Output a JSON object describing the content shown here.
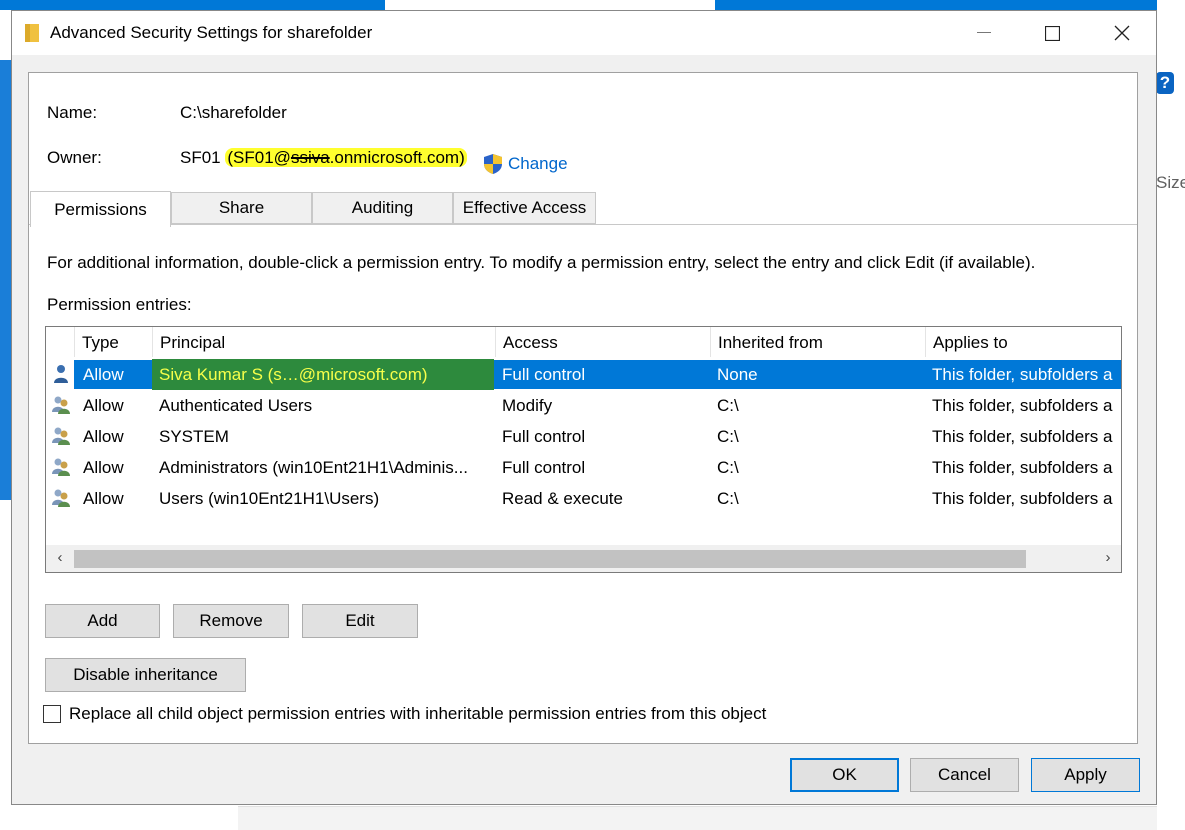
{
  "window": {
    "title": "Advanced Security Settings for sharefolder"
  },
  "object": {
    "name_label": "Name:",
    "name_value": "C:\\sharefolder",
    "owner_label": "Owner:",
    "owner_name": "SF01",
    "owner_email_prefix": "(SF01@",
    "owner_email_struck": "ssiva",
    "owner_email_suffix": ".onmicrosoft.com)",
    "change_link": "Change"
  },
  "tabs": [
    {
      "label": "Permissions",
      "active": true
    },
    {
      "label": "Share",
      "active": false
    },
    {
      "label": "Auditing",
      "active": false
    },
    {
      "label": "Effective Access",
      "active": false
    }
  ],
  "info_text": "For additional information, double-click a permission entry. To modify a permission entry, select the entry and click Edit (if available).",
  "entries_label": "Permission entries:",
  "table": {
    "columns": [
      "Type",
      "Principal",
      "Access",
      "Inherited from",
      "Applies to"
    ],
    "rows": [
      {
        "icon": "user-icon",
        "type": "Allow",
        "principal": "Siva Kumar S (s…@microsoft.com)",
        "access": "Full control",
        "inherited": "None",
        "applies": "This folder, subfolders a",
        "selected": true
      },
      {
        "icon": "group-icon",
        "type": "Allow",
        "principal": "Authenticated Users",
        "access": "Modify",
        "inherited": "C:\\",
        "applies": "This folder, subfolders a",
        "selected": false
      },
      {
        "icon": "group-icon",
        "type": "Allow",
        "principal": "SYSTEM",
        "access": "Full control",
        "inherited": "C:\\",
        "applies": "This folder, subfolders a",
        "selected": false
      },
      {
        "icon": "group-icon",
        "type": "Allow",
        "principal": "Administrators (win10Ent21H1\\Adminis...",
        "access": "Full control",
        "inherited": "C:\\",
        "applies": "This folder, subfolders a",
        "selected": false
      },
      {
        "icon": "group-icon",
        "type": "Allow",
        "principal": "Users (win10Ent21H1\\Users)",
        "access": "Read & execute",
        "inherited": "C:\\",
        "applies": "This folder, subfolders a",
        "selected": false
      }
    ]
  },
  "buttons": {
    "add": "Add",
    "remove": "Remove",
    "edit": "Edit",
    "disable_inheritance": "Disable inheritance",
    "ok": "OK",
    "cancel": "Cancel",
    "apply": "Apply"
  },
  "checkbox": {
    "label": "Replace all child object permission entries with inheritable permission entries from this object",
    "checked": false
  },
  "background": {
    "help": "?",
    "size_fragment": "Size"
  },
  "colors": {
    "selection": "#0078d7",
    "link": "#0066cc",
    "highlight": "#ffff2e"
  }
}
